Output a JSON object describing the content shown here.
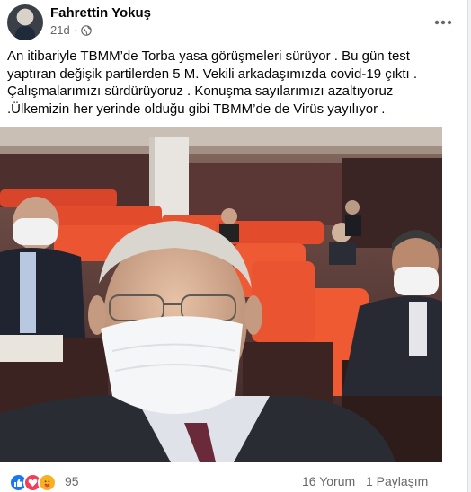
{
  "post": {
    "author": "Fahrettin Yokuş",
    "time": "21d",
    "privacy_icon": "globe-icon",
    "text_lines": [
      "An itibariyle TBMM’de Torba yasa görüşmeleri sürüyor . Bu gün test",
      "yaptıran değişik partilerden 5 M. Vekili arkadaşımızda covid-19  çıktı .",
      "Çalışmalarımızı sürdürüyoruz . Konuşma sayılarımızı azaltıyoruz",
      ".Ülkemizin her yerinde olduğu gibi TBMM’de de Virüs yayılıyor ."
    ]
  },
  "reactions": {
    "icons": [
      "like-icon",
      "love-icon",
      "care-icon"
    ],
    "count": "95"
  },
  "stats": {
    "comments": "16 Yorum",
    "shares": "1 Paylaşım"
  },
  "colors": {
    "like": "#1877f2",
    "love": "#f33e58",
    "care": "#f7b125",
    "seat": "#e84b26"
  }
}
